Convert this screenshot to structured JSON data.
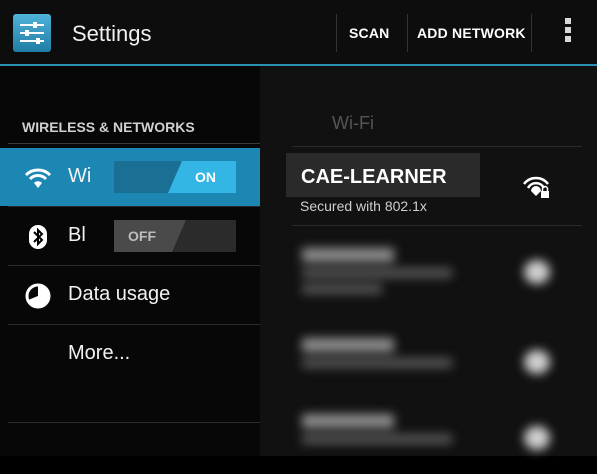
{
  "app": {
    "title": "Settings",
    "icon": "settings-sliders-icon"
  },
  "actionbar": {
    "scan_label": "SCAN",
    "add_network_label": "ADD NETWORK",
    "overflow_icon": "overflow-menu-icon"
  },
  "sidebar": {
    "section_header": "WIRELESS & NETWORKS",
    "items": [
      {
        "label": "Wi",
        "icon": "wifi-icon",
        "toggle": "ON",
        "selected": true
      },
      {
        "label": "Bl",
        "icon": "bluetooth-icon",
        "toggle": "OFF",
        "selected": false
      },
      {
        "label": "Data usage",
        "icon": "data-usage-icon"
      },
      {
        "label": "More..."
      }
    ]
  },
  "wifi_panel": {
    "title": "Wi-Fi",
    "networks": [
      {
        "ssid": "CAE-LEARNER",
        "status": "Secured with 802.1x",
        "icon": "wifi-signal-locked-icon"
      }
    ]
  },
  "colors": {
    "accent": "#33b5e5",
    "selected_row": "#1c87b3",
    "background": "#000000"
  }
}
